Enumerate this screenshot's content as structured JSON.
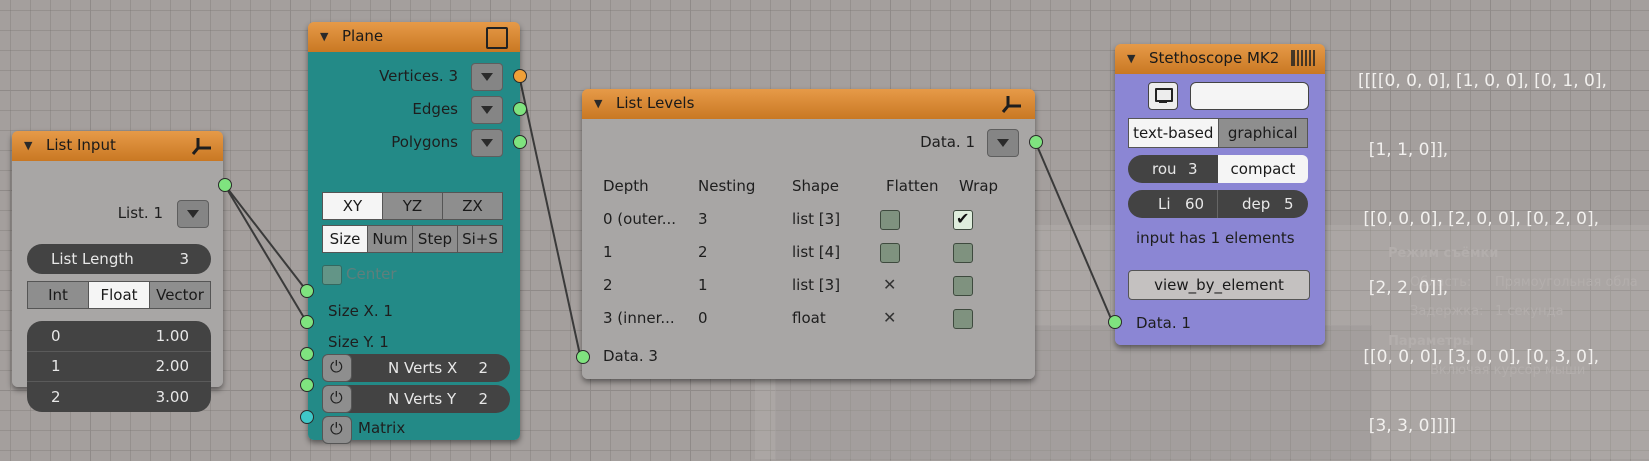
{
  "list_input": {
    "title": "List Input",
    "output_label": "List. 1",
    "length_label": "List Length",
    "length_value": "3",
    "modes": [
      "Int",
      "Float",
      "Vector"
    ],
    "rows": [
      {
        "idx": "0",
        "val": "1.00"
      },
      {
        "idx": "1",
        "val": "2.00"
      },
      {
        "idx": "2",
        "val": "3.00"
      }
    ]
  },
  "plane": {
    "title": "Plane",
    "outputs": [
      "Vertices. 3",
      "Edges",
      "Polygons"
    ],
    "planes": [
      "XY",
      "YZ",
      "ZX"
    ],
    "modes": [
      "Size",
      "Num",
      "Step",
      "Si+S"
    ],
    "center_label": "Center",
    "inputs": [
      "Size X. 1",
      "Size Y. 1"
    ],
    "n_verts_x": {
      "label": "N Verts X",
      "value": "2"
    },
    "n_verts_y": {
      "label": "N Verts Y",
      "value": "2"
    },
    "matrix_label": "Matrix"
  },
  "list_levels": {
    "title": "List Levels",
    "output_label": "Data. 1",
    "columns": [
      "Depth",
      "Nesting",
      "Shape",
      "Flatten",
      "Wrap"
    ],
    "rows": [
      {
        "depth": "0 (outer...",
        "nesting": "3",
        "shape": "list [3]"
      },
      {
        "depth": "1",
        "nesting": "2",
        "shape": "list [4]"
      },
      {
        "depth": "2",
        "nesting": "1",
        "shape": "list [3]"
      },
      {
        "depth": "3 (inner...",
        "nesting": "0",
        "shape": "float"
      }
    ],
    "input_label": "Data. 3"
  },
  "stethoscope": {
    "title": "Stethoscope MK2",
    "text_field": "",
    "modes": [
      "text-based",
      "graphical"
    ],
    "rou_label": "rou",
    "rou_value": "3",
    "compact_label": "compact",
    "li_label": "Li",
    "li_value": "60",
    "dep_label": "dep",
    "dep_value": "5",
    "info": "input has 1 elements",
    "view_button": "view_by_element",
    "input_label": "Data. 1"
  },
  "output_text": [
    "[[[[0, 0, 0], [1, 0, 0], [0, 1, 0],",
    "  [1, 1, 0]],",
    " [[0, 0, 0], [2, 0, 0], [0, 2, 0],",
    "  [2, 2, 0]],",
    " [[0, 0, 0], [3, 0, 0], [0, 3, 0],",
    "  [3, 3, 0]]]]"
  ],
  "ghost": {
    "heading1": "Режим съёмки",
    "area_label": "Область:",
    "area_value": "Прямоугольная обла",
    "delay_label": "Задержка:",
    "delay_value": "1 секунда",
    "heading2": "Параметры",
    "cursor_label": "Включая курсор мыши"
  },
  "colors": {
    "header": "#d98a35",
    "plane_body": "#238a87",
    "stethoscope_body": "#8b86d4",
    "socket_green": "#7fe37f",
    "socket_orange": "#f0a038",
    "socket_teal": "#3fc8c8"
  }
}
